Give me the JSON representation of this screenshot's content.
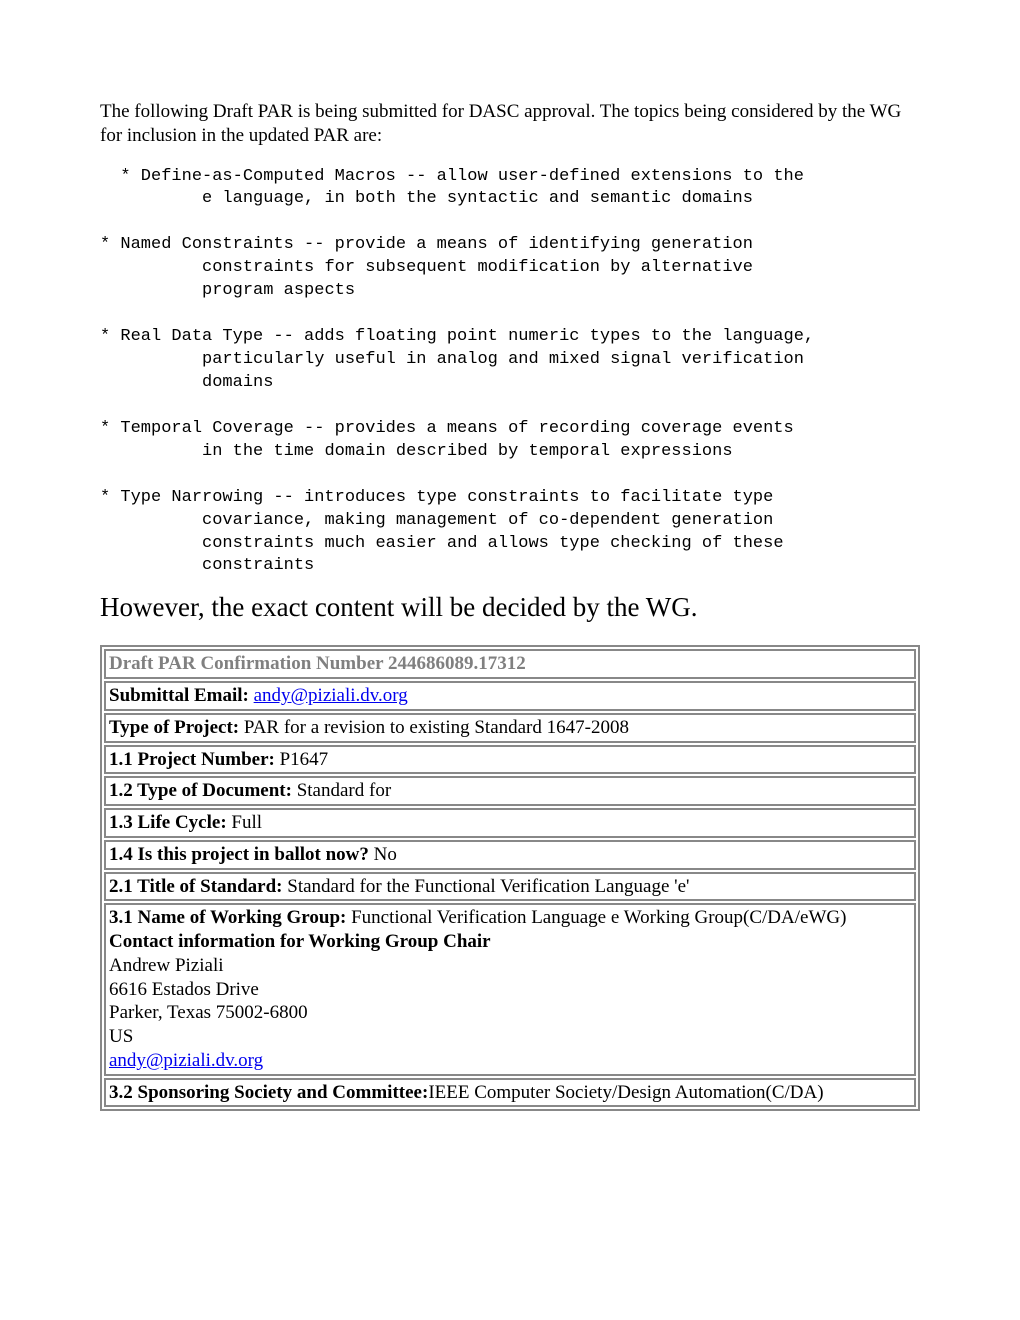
{
  "intro": "The following Draft PAR is being submitted for DASC approval. The topics being considered by the WG for inclusion in the updated PAR are:",
  "topics": "  * Define-as-Computed Macros -- allow user-defined extensions to the\n          e language, in both the syntactic and semantic domains\n\n* Named Constraints -- provide a means of identifying generation\n          constraints for subsequent modification by alternative\n          program aspects\n\n* Real Data Type -- adds floating point numeric types to the language,\n          particularly useful in analog and mixed signal verification\n          domains\n\n* Temporal Coverage -- provides a means of recording coverage events\n          in the time domain described by temporal expressions\n\n* Type Narrowing -- introduces type constraints to facilitate type\n          covariance, making management of co-dependent generation\n          constraints much easier and allows type checking of these\n          constraints",
  "however": "However, the exact content will be decided by the WG.",
  "rows": {
    "r0": "Draft PAR Confirmation Number 244686089.17312",
    "r1_label": "Submittal Email: ",
    "r1_link": "andy@piziali.dv.org",
    "r2_label": "Type of Project: ",
    "r2_value": "PAR for a revision to existing Standard 1647-2008",
    "r3_label": "1.1 Project Number: ",
    "r3_value": "P1647",
    "r4_label": "1.2 Type of Document: ",
    "r4_value": "Standard for",
    "r5_label": "1.3 Life Cycle: ",
    "r5_value": "Full",
    "r6_label": "1.4 Is this project in ballot now? ",
    "r6_value": "No",
    "r7_label": "2.1 Title of Standard: ",
    "r7_value": "Standard for the Functional Verification Language 'e'",
    "r8_label": "3.1 Name of Working Group: ",
    "r8_value": "Functional Verification Language e Working Group(C/DA/eWG)",
    "r8_sub_label": "Contact information for Working Group Chair",
    "r8_name": "Andrew Piziali",
    "r8_addr1": "6616 Estados Drive",
    "r8_addr2": "Parker, Texas 75002-6800",
    "r8_country": "US",
    "r8_email": "andy@piziali.dv.org",
    "r9_label": "3.2 Sponsoring Society and Committee:",
    "r9_value": "IEEE Computer Society/Design Automation(C/DA)"
  }
}
